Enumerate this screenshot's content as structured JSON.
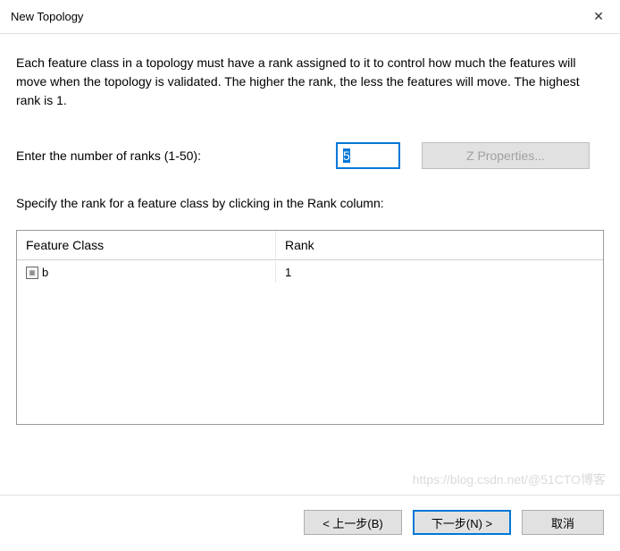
{
  "titlebar": {
    "title": "New Topology"
  },
  "description": "Each feature class in a topology must have a rank assigned to it to control how much the features will move when the topology is validated. The higher the rank, the less the features will move. The highest rank is 1.",
  "rank_input": {
    "label": "Enter the number of ranks  (1-50):",
    "value": "5"
  },
  "z_properties_label": "Z Properties...",
  "specify_label": "Specify the rank for a feature class by clicking in the Rank column:",
  "table": {
    "headers": {
      "feature_class": "Feature Class",
      "rank": "Rank"
    },
    "rows": [
      {
        "name": "b",
        "rank": "1"
      }
    ]
  },
  "footer": {
    "back": "< 上一步(B)",
    "next": "下一步(N) >",
    "cancel": "取消"
  },
  "watermark": "https://blog.csdn.net/@51CTO博客"
}
